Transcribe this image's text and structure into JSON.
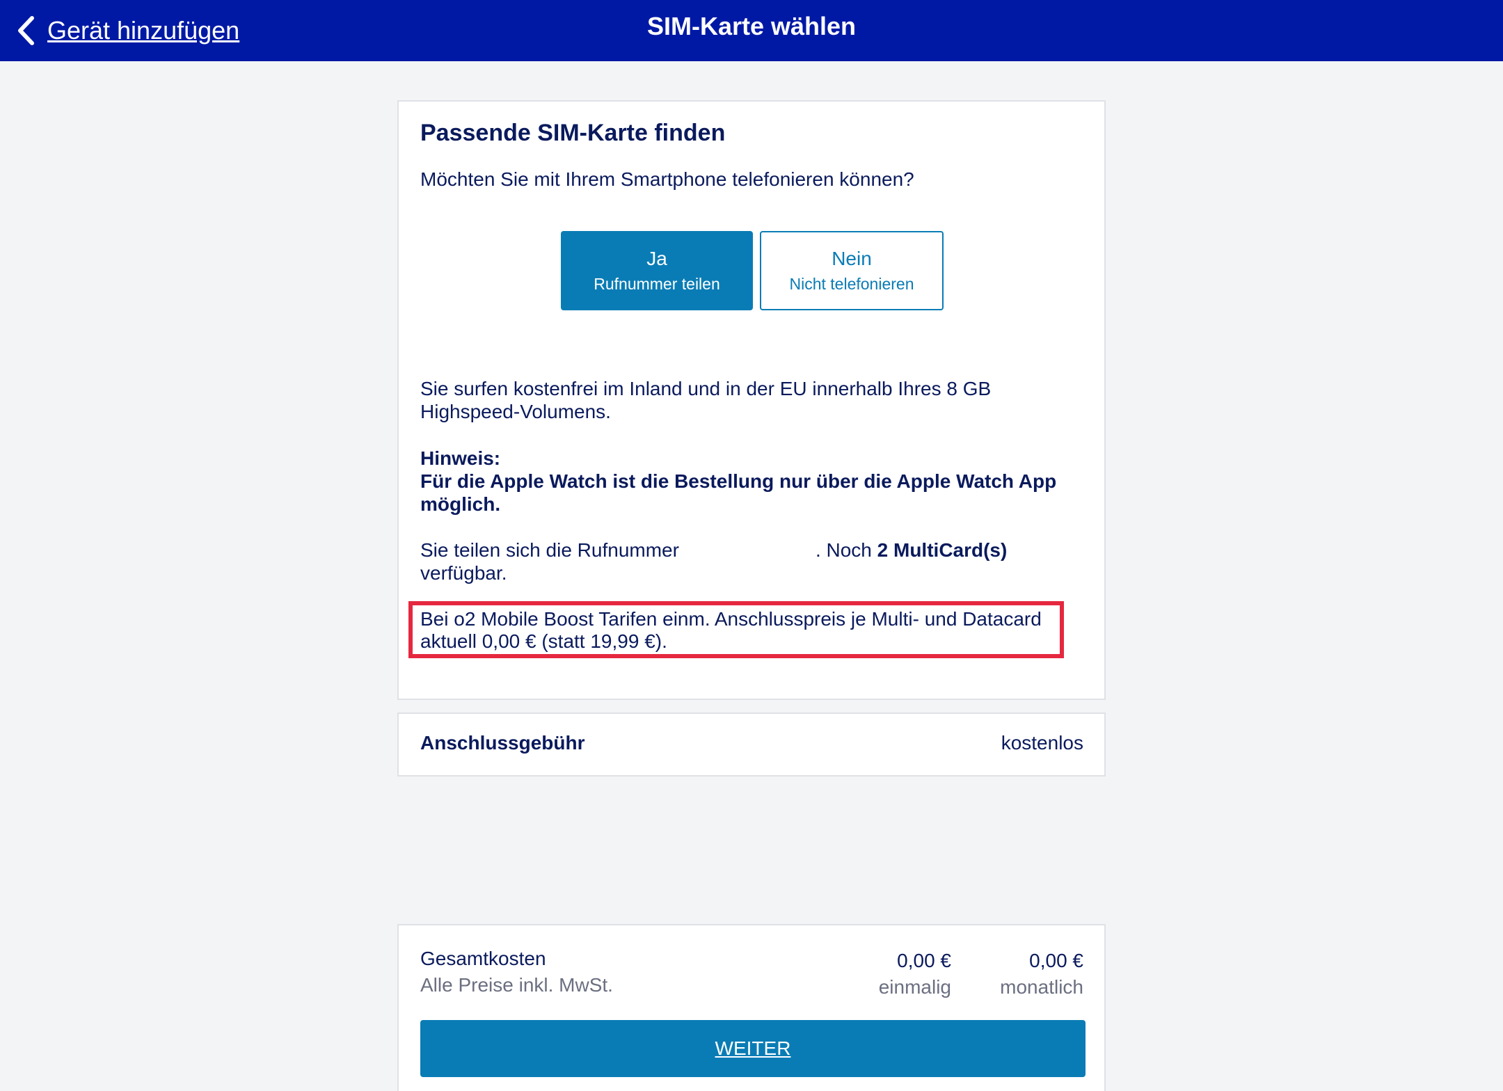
{
  "colors": {
    "header_bg": "#0019a5",
    "primary_button": "#0a7cb5",
    "highlight_border": "#e5283f",
    "page_bg": "#f3f4f6"
  },
  "header": {
    "back_icon": "chevron-left-icon",
    "back_label": "Gerät hinzufügen",
    "title": "SIM-Karte wählen"
  },
  "sim_card": {
    "heading": "Passende SIM-Karte finden",
    "question": "Möchten Sie mit Ihrem Smartphone telefonieren können?",
    "options": [
      {
        "label": "Ja",
        "sublabel": "Rufnummer teilen",
        "selected": true
      },
      {
        "label": "Nein",
        "sublabel": "Nicht telefonieren",
        "selected": false
      }
    ],
    "surf_text": "Sie surfen kostenfrei im Inland und in der EU innerhalb Ihres 8 GB Highspeed-Volumens.",
    "hint_title": "Hinweis:",
    "hint_text": "Für die Apple Watch ist die Bestellung nur über die Apple Watch App möglich.",
    "share_prefix": "Sie teilen sich die Rufnummer",
    "share_middle": ". Noch ",
    "share_count": "2 MultiCard(s)",
    "share_suffix": " verfügbar.",
    "promo_text": "Bei o2 Mobile Boost Tarifen einm. Anschlusspreis je Multi- und Datacard aktuell 0,00 € (statt 19,99 €)."
  },
  "fee": {
    "label": "Anschlussgebühr",
    "value": "kostenlos"
  },
  "total": {
    "label": "Gesamtkosten",
    "note": "Alle Preise inkl. MwSt.",
    "once_amount": "0,00 €",
    "once_label": "einmalig",
    "monthly_amount": "0,00 €",
    "monthly_label": "monatlich",
    "next_button": "WEITER"
  }
}
